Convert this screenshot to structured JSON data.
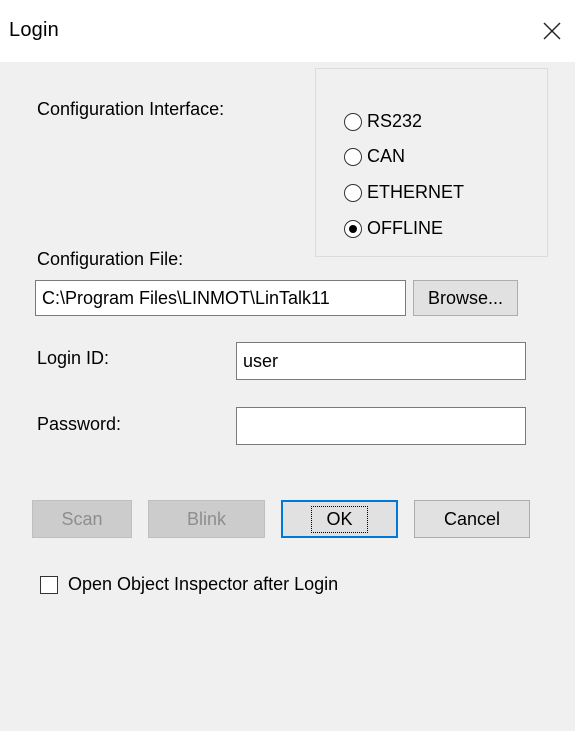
{
  "window": {
    "title": "Login"
  },
  "labels": {
    "config_interface": "Configuration Interface:",
    "config_file": "Configuration File:",
    "login_id": "Login ID:",
    "password": "Password:"
  },
  "interface_options": [
    {
      "label": "RS232",
      "checked": false
    },
    {
      "label": "CAN",
      "checked": false
    },
    {
      "label": "ETHERNET",
      "checked": false
    },
    {
      "label": "OFFLINE",
      "checked": true
    }
  ],
  "fields": {
    "config_file_value": "C:\\Program Files\\LINMOT\\LinTalk11",
    "login_id_value": "user",
    "password_value": ""
  },
  "buttons": {
    "browse": "Browse...",
    "scan": "Scan",
    "blink": "Blink",
    "ok": "OK",
    "cancel": "Cancel"
  },
  "options": {
    "open_inspector": "Open Object Inspector after Login",
    "open_inspector_checked": false
  },
  "colors": {
    "focus_border": "#0078d7",
    "window_bg": "#f0f0f0"
  }
}
